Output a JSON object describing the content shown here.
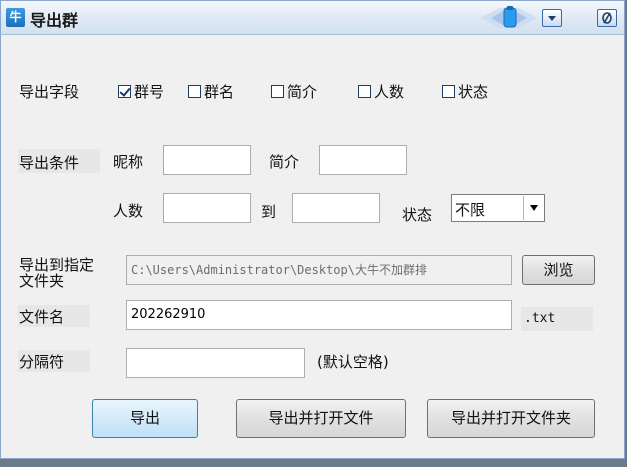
{
  "window": {
    "app_icon": "牛",
    "title": "导出群",
    "minimize_icon": "minimize-icon",
    "close_icon": "close-icon"
  },
  "fields": {
    "label": "导出字段",
    "options": [
      {
        "label": "群号",
        "checked": true
      },
      {
        "label": "群名",
        "checked": false
      },
      {
        "label": "简介",
        "checked": false
      },
      {
        "label": "人数",
        "checked": false
      },
      {
        "label": "状态",
        "checked": false
      }
    ]
  },
  "conditions": {
    "label": "导出条件",
    "nickname_label": "昵称",
    "nickname_value": "",
    "intro_label": "简介",
    "intro_value": "",
    "count_label": "人数",
    "count_from": "",
    "to_label": "到",
    "count_to": "",
    "status_label": "状态",
    "status_value": "不限"
  },
  "export_path": {
    "label_line1": "导出到指定",
    "label_line2": "文件夹",
    "value": "C:\\Users\\Administrator\\Desktop\\大牛不加群排",
    "browse_label": "浏览"
  },
  "filename": {
    "label": "文件名",
    "value": "202262910",
    "ext": ".txt"
  },
  "separator": {
    "label": "分隔符",
    "value": "",
    "hint": "(默认空格)"
  },
  "buttons": {
    "export": "导出",
    "export_open_file": "导出并打开文件",
    "export_open_folder": "导出并打开文件夹"
  }
}
